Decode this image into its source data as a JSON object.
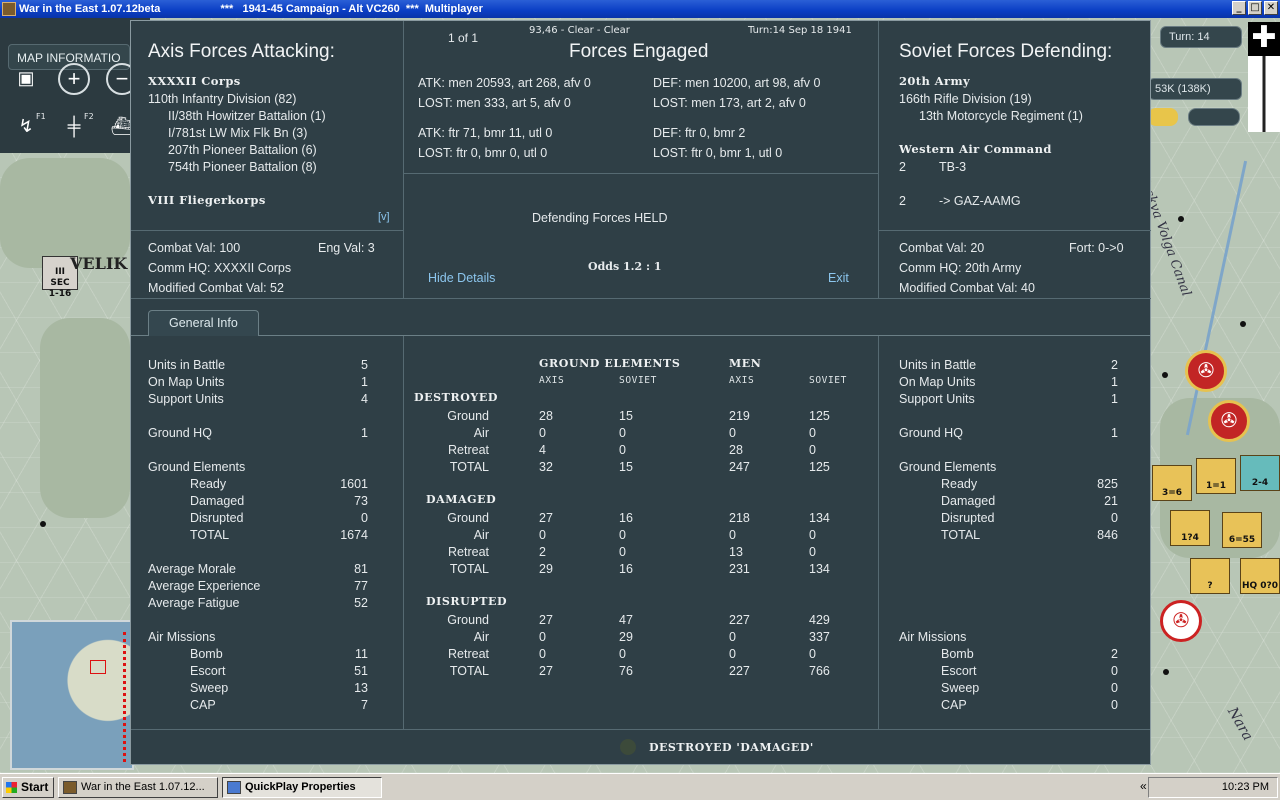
{
  "window": {
    "title": "War in the East 1.07.12beta",
    "subtitle": "***   1941-45 Campaign - Alt VC260  ***  Multiplayer",
    "buttons": [
      "_",
      "□",
      "✕"
    ]
  },
  "map_ui": {
    "info_tab": "MAP INFORMATIO",
    "turn_box": "Turn: 14",
    "supply_box": "53K (138K)",
    "toolbar_f1": "F1",
    "toolbar_f2": "F2",
    "sec_counter_top": "III",
    "sec_counter_label": "SEC",
    "sec_counter_value": "1-16",
    "city_label": "VELIK",
    "river_label": "Moskva Volga Canal",
    "river_label_2": "Nara",
    "counters": [
      {
        "label": "3=6"
      },
      {
        "label": "1=1"
      },
      {
        "label": "2-4"
      },
      {
        "label": "1?4"
      },
      {
        "label": "6=55"
      },
      {
        "label": "?"
      },
      {
        "label": "HQ 0?0"
      }
    ]
  },
  "dialog": {
    "pagination": "1 of 1",
    "location": "93,46 - Clear - Clear",
    "turn_date": "Turn:14  Sep 18 1941",
    "attacker_title": "Axis Forces Attacking:",
    "engaged_title": "Forces Engaged",
    "defender_title": "Soviet Forces Defending:",
    "attacker": {
      "corps": "XXXXII Corps",
      "units": [
        "110th Infantry Division (82)",
        "II/38th Howitzer Battalion (1)",
        "I/781st LW Mix Flk Bn (3)",
        "207th Pioneer Battalion (6)",
        "754th Pioneer Battalion (8)"
      ],
      "air_corps": "VIII Fliegerkorps",
      "scroll_marker": "[v]",
      "combat_val": "Combat Val: 100",
      "eng_val": "Eng Val: 3",
      "comm_hq": "Comm HQ: XXXXII Corps",
      "modified": "Modified Combat Val: 52"
    },
    "engaged": {
      "atk_ground": "ATK: men 20593, art 268, afv 0",
      "atk_ground_lost": "LOST: men 333, art 5, afv 0",
      "def_ground": "DEF: men 10200, art 98, afv 0",
      "def_ground_lost": "LOST: men 173, art 2, afv 0",
      "atk_air": "ATK: ftr 71, bmr 11, utl 0",
      "atk_air_lost": "LOST: ftr 0, bmr 0, utl 0",
      "def_air": "DEF: ftr 0, bmr 2",
      "def_air_lost": "LOST: ftr 0, bmr 1, utl 0",
      "result": "Defending Forces HELD",
      "odds": "Odds 1.2 : 1",
      "hide_details": "Hide Details",
      "exit": "Exit"
    },
    "defender": {
      "army": "20th Army",
      "units": [
        "166th Rifle Division (19)",
        "13th Motorcycle Regiment (1)"
      ],
      "air_command": "Western Air Command",
      "air_units": [
        {
          "count": "2",
          "name": "TB-3"
        },
        {
          "count": "2",
          "name": "-> GAZ-AAMG"
        }
      ],
      "combat_val": "Combat Val: 20",
      "fort": "Fort: 0->0",
      "comm_hq": "Comm HQ: 20th Army",
      "modified": "Modified Combat Val: 40"
    },
    "tab_general": "General Info",
    "left_stats": {
      "units_in_battle": {
        "label": "Units in Battle",
        "value": "5"
      },
      "on_map_units": {
        "label": "On Map Units",
        "value": "1"
      },
      "support_units": {
        "label": "Support Units",
        "value": "4"
      },
      "ground_hq": {
        "label": "Ground HQ",
        "value": "1"
      },
      "ground_elements": "Ground Elements",
      "ready": {
        "label": "Ready",
        "value": "1601"
      },
      "damaged": {
        "label": "Damaged",
        "value": "73"
      },
      "disrupted": {
        "label": "Disrupted",
        "value": "0"
      },
      "total": {
        "label": "TOTAL",
        "value": "1674"
      },
      "avg_morale": {
        "label": "Average Morale",
        "value": "81"
      },
      "avg_experience": {
        "label": "Average Experience",
        "value": "77"
      },
      "avg_fatigue": {
        "label": "Average Fatigue",
        "value": "52"
      },
      "air_missions": "Air Missions",
      "bomb": {
        "label": "Bomb",
        "value": "11"
      },
      "escort": {
        "label": "Escort",
        "value": "51"
      },
      "sweep": {
        "label": "Sweep",
        "value": "13"
      },
      "cap": {
        "label": "CAP",
        "value": "7"
      }
    },
    "right_stats": {
      "units_in_battle": {
        "label": "Units in Battle",
        "value": "2"
      },
      "on_map_units": {
        "label": "On Map Units",
        "value": "1"
      },
      "support_units": {
        "label": "Support Units",
        "value": "1"
      },
      "ground_hq": {
        "label": "Ground HQ",
        "value": "1"
      },
      "ground_elements": "Ground Elements",
      "ready": {
        "label": "Ready",
        "value": "825"
      },
      "damaged": {
        "label": "Damaged",
        "value": "21"
      },
      "disrupted": {
        "label": "Disrupted",
        "value": "0"
      },
      "total": {
        "label": "TOTAL",
        "value": "846"
      },
      "air_missions": "Air Missions",
      "bomb": {
        "label": "Bomb",
        "value": "2"
      },
      "escort": {
        "label": "Escort",
        "value": "0"
      },
      "sweep": {
        "label": "Sweep",
        "value": "0"
      },
      "cap": {
        "label": "CAP",
        "value": "0"
      }
    },
    "losses": {
      "ground_elements_header": "GROUND ELEMENTS",
      "men_header": "MEN",
      "axis": "AXIS",
      "soviet": "SOVIET",
      "sections": [
        {
          "title": "DESTROYED",
          "rows": [
            {
              "label": "Ground",
              "ge_axis": "28",
              "ge_soviet": "15",
              "men_axis": "219",
              "men_soviet": "125"
            },
            {
              "label": "Air",
              "ge_axis": "0",
              "ge_soviet": "0",
              "men_axis": "0",
              "men_soviet": "0"
            },
            {
              "label": "Retreat",
              "ge_axis": "4",
              "ge_soviet": "0",
              "men_axis": "28",
              "men_soviet": "0"
            },
            {
              "label": "TOTAL",
              "ge_axis": "32",
              "ge_soviet": "15",
              "men_axis": "247",
              "men_soviet": "125"
            }
          ]
        },
        {
          "title": "DAMAGED",
          "rows": [
            {
              "label": "Ground",
              "ge_axis": "27",
              "ge_soviet": "16",
              "men_axis": "218",
              "men_soviet": "134"
            },
            {
              "label": "Air",
              "ge_axis": "0",
              "ge_soviet": "0",
              "men_axis": "0",
              "men_soviet": "0"
            },
            {
              "label": "Retreat",
              "ge_axis": "2",
              "ge_soviet": "0",
              "men_axis": "13",
              "men_soviet": "0"
            },
            {
              "label": "TOTAL",
              "ge_axis": "29",
              "ge_soviet": "16",
              "men_axis": "231",
              "men_soviet": "134"
            }
          ]
        },
        {
          "title": "DISRUPTED",
          "rows": [
            {
              "label": "Ground",
              "ge_axis": "27",
              "ge_soviet": "47",
              "men_axis": "227",
              "men_soviet": "429"
            },
            {
              "label": "Air",
              "ge_axis": "0",
              "ge_soviet": "29",
              "men_axis": "0",
              "men_soviet": "337"
            },
            {
              "label": "Retreat",
              "ge_axis": "0",
              "ge_soviet": "0",
              "men_axis": "0",
              "men_soviet": "0"
            },
            {
              "label": "TOTAL",
              "ge_axis": "27",
              "ge_soviet": "76",
              "men_axis": "227",
              "men_soviet": "766"
            }
          ]
        }
      ]
    },
    "footer_label": "DESTROYED 'DAMAGED'"
  },
  "taskbar": {
    "start": "Start",
    "tasks": [
      {
        "label": "War in the East 1.07.12...",
        "active": false
      },
      {
        "label": "QuickPlay Properties",
        "active": true
      }
    ],
    "chevron": "«",
    "clock": "10:23 PM"
  }
}
